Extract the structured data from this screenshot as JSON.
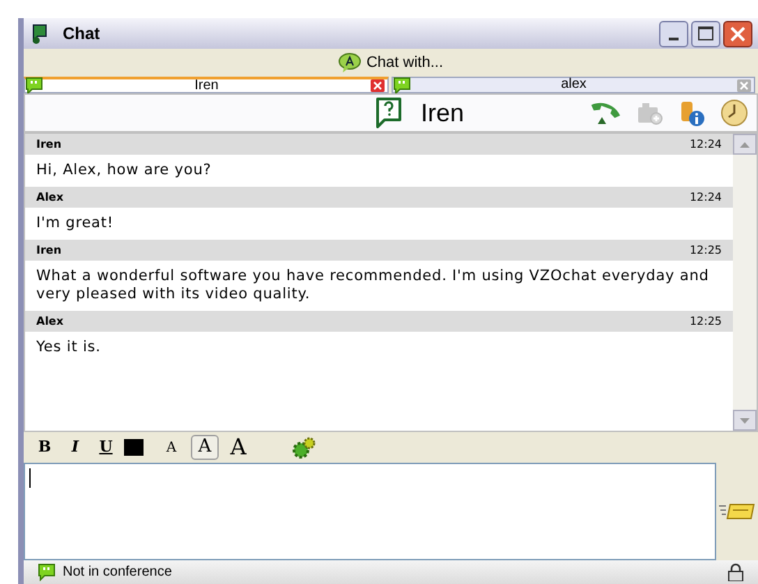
{
  "window": {
    "title": "Chat"
  },
  "chat_with": {
    "label": "Chat with..."
  },
  "tabs": [
    {
      "label": "Iren",
      "selected": true
    },
    {
      "label": "alex",
      "selected": false
    }
  ],
  "contact": {
    "name": "Iren"
  },
  "messages": [
    {
      "sender": "Iren",
      "time": "12:24",
      "text": "Hi, Alex, how are you?"
    },
    {
      "sender": "Alex",
      "time": "12:24",
      "text": "I'm great!"
    },
    {
      "sender": "Iren",
      "time": "12:25",
      "text": "What a wonderful software you have recommended. I'm using VZOchat everyday and very pleased with its video quality."
    },
    {
      "sender": "Alex",
      "time": "12:25",
      "text": "Yes it is."
    }
  ],
  "format_bar": {
    "bold": "B",
    "italic": "I",
    "underline": "U",
    "sizes": [
      {
        "label": "A",
        "selected": false
      },
      {
        "label": "A",
        "selected": true
      },
      {
        "label": "A",
        "selected": false
      }
    ]
  },
  "status_bar": {
    "text": "Not in conference"
  }
}
